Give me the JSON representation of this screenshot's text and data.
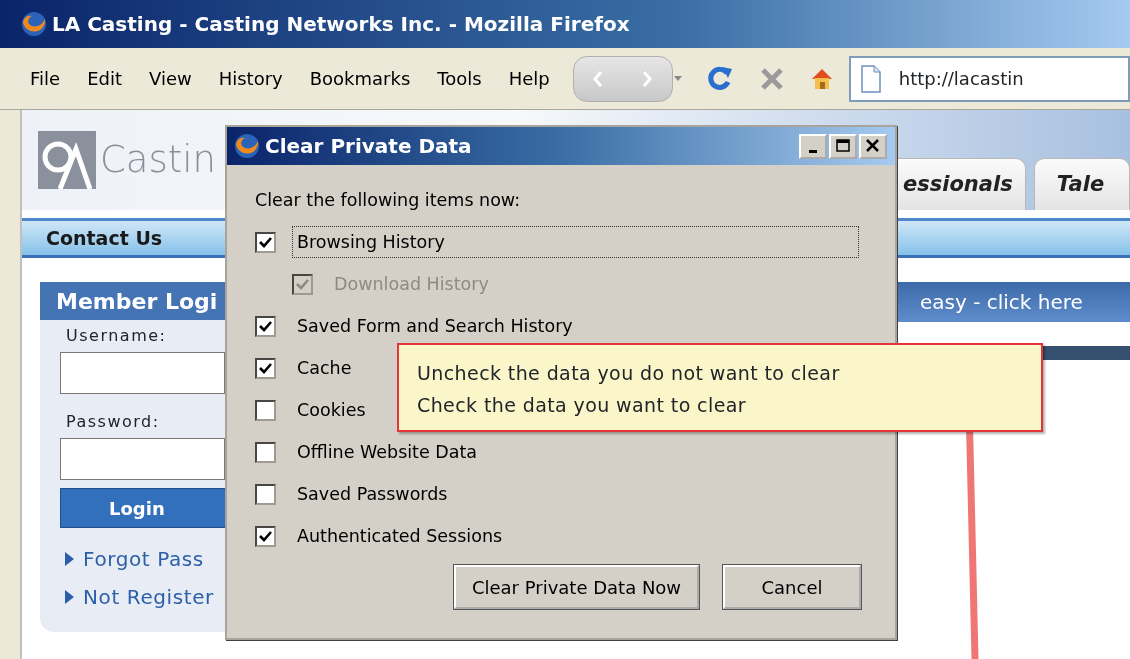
{
  "window": {
    "title": "LA Casting - Casting Networks Inc. - Mozilla Firefox"
  },
  "menu": [
    {
      "label": "File"
    },
    {
      "label": "Edit"
    },
    {
      "label": "View"
    },
    {
      "label": "History"
    },
    {
      "label": "Bookmarks"
    },
    {
      "label": "Tools"
    },
    {
      "label": "Help"
    }
  ],
  "address": {
    "value": "http://lacastin"
  },
  "page": {
    "logo_text": "Castin",
    "tabs": [
      {
        "label": "essionals"
      },
      {
        "label": "Tale"
      }
    ],
    "nav": [
      "Contact Us"
    ],
    "login": {
      "title": "Member Logi",
      "username_label": "Username:",
      "password_label": "Password:",
      "button": "Login",
      "links": [
        "Forgot Pass",
        "Not Register"
      ]
    },
    "banner": "easy - click here"
  },
  "dialog": {
    "title": "Clear Private Data",
    "prompt": "Clear the following items now:",
    "items": [
      {
        "label": "Browsing History",
        "checked": true,
        "disabled": false,
        "focused": true,
        "children": [
          {
            "label": "Download History",
            "checked": true,
            "disabled": true,
            "focused": false
          }
        ]
      },
      {
        "label": "Saved Form and Search History",
        "checked": true,
        "disabled": false,
        "focused": false
      },
      {
        "label": "Cache",
        "checked": true,
        "disabled": false,
        "focused": false
      },
      {
        "label": "Cookies",
        "checked": false,
        "disabled": false,
        "focused": false
      },
      {
        "label": "Offline Website Data",
        "checked": false,
        "disabled": false,
        "focused": false
      },
      {
        "label": "Saved Passwords",
        "checked": false,
        "disabled": false,
        "focused": false
      },
      {
        "label": "Authenticated Sessions",
        "checked": true,
        "disabled": false,
        "focused": false
      }
    ],
    "buttons": [
      "Clear Private Data Now",
      "Cancel"
    ]
  },
  "callout": {
    "lines": [
      "Uncheck the data you do not want to clear",
      "Check the data you want to clear"
    ]
  }
}
